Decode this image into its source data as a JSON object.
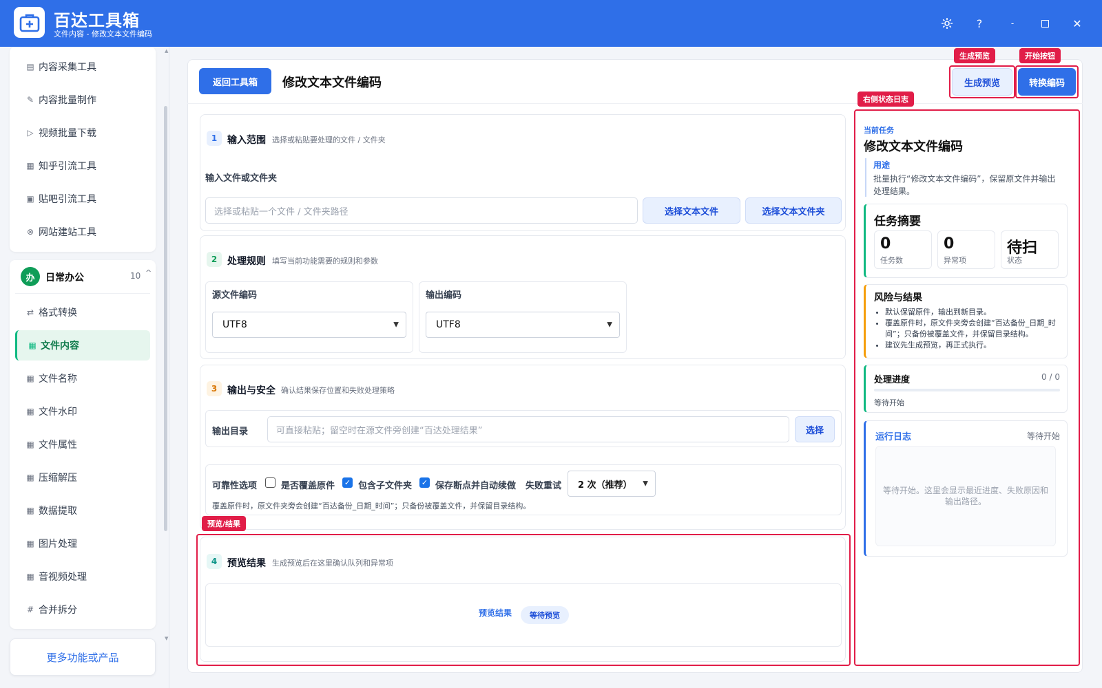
{
  "app": {
    "title": "百达工具箱",
    "subtitle": "文件内容 - 修改文本文件编码"
  },
  "window_controls": {
    "help": "?",
    "minimize": "-",
    "close": "✕"
  },
  "sidebar": {
    "group1_items": [
      {
        "label": "内容采集工具",
        "icon": "document-icon"
      },
      {
        "label": "内容批量制作",
        "icon": "pencil-icon"
      },
      {
        "label": "视频批量下载",
        "icon": "video-icon"
      },
      {
        "label": "知乎引流工具",
        "icon": "zhihu-icon"
      },
      {
        "label": "贴吧引流工具",
        "icon": "tieba-icon"
      },
      {
        "label": "网站建站工具",
        "icon": "web-icon"
      }
    ],
    "group2": {
      "badge": "办",
      "label": "日常办公",
      "count": "10"
    },
    "group2_items": [
      {
        "label": "格式转换",
        "icon": "swap-icon"
      },
      {
        "label": "文件内容",
        "icon": "grid-icon"
      },
      {
        "label": "文件名称",
        "icon": "grid-icon"
      },
      {
        "label": "文件水印",
        "icon": "grid-icon"
      },
      {
        "label": "文件属性",
        "icon": "grid-icon"
      },
      {
        "label": "压缩解压",
        "icon": "grid-icon"
      },
      {
        "label": "数据提取",
        "icon": "grid-icon"
      },
      {
        "label": "图片处理",
        "icon": "grid-icon"
      },
      {
        "label": "音视频处理",
        "icon": "grid-icon"
      },
      {
        "label": "合并拆分",
        "icon": "hash-icon"
      }
    ],
    "more": "更多功能或产品"
  },
  "header": {
    "back": "返回工具箱",
    "title": "修改文本文件编码",
    "preview_btn": "生成预览",
    "start_btn": "转换编码"
  },
  "sections": {
    "s1": {
      "num": "1",
      "title": "输入范围",
      "desc": "选择或粘贴要处理的文件 / 文件夹",
      "field_label": "输入文件或文件夹",
      "placeholder": "选择或粘贴一个文件 / 文件夹路径",
      "btn_file": "选择文本文件",
      "btn_folder": "选择文本文件夹"
    },
    "s2": {
      "num": "2",
      "title": "处理规则",
      "desc": "填写当前功能需要的规则和参数",
      "src_label": "源文件编码",
      "src_value": "UTF8",
      "out_label": "输出编码",
      "out_value": "UTF8"
    },
    "s3": {
      "num": "3",
      "title": "输出与安全",
      "desc": "确认结果保存位置和失败处理策略",
      "dir_label": "输出目录",
      "dir_placeholder": "可直接粘贴；留空时在源文件旁创建“百达处理结果”",
      "dir_btn": "选择",
      "rel_label": "可靠性选项",
      "opt_overwrite": "是否覆盖原件",
      "opt_subfolder": "包含子文件夹",
      "opt_resume": "保存断点并自动续做",
      "retry_label": "失败重试",
      "retry_value": "2 次（推荐）",
      "note": "覆盖原件时，原文件夹旁会创建“百达备份_日期_时间”；只备份被覆盖文件，并保留目录结构。"
    },
    "s4": {
      "num": "4",
      "title": "预览结果",
      "desc": "生成预览后在这里确认队列和异常项",
      "result_label": "预览结果",
      "result_status": "等待预览"
    }
  },
  "annotations": {
    "preview_tag": "生成预览",
    "start_tag": "开始按钮",
    "log_tag": "右侧状态日志",
    "result_tag": "预览/结果"
  },
  "right": {
    "current_label": "当前任务",
    "task_title": "修改文本文件编码",
    "purpose_label": "用途",
    "purpose_text": "批量执行“修改文本文件编码”，保留原文件并输出处理结果。",
    "summary_title": "任务摘要",
    "stats": [
      {
        "value": "0",
        "label": "任务数"
      },
      {
        "value": "0",
        "label": "异常项"
      },
      {
        "value": "待扫",
        "label": "状态"
      }
    ],
    "risk_title": "风险与结果",
    "risks": [
      "默认保留原件，输出到新目录。",
      "覆盖原件时，原文件夹旁会创建“百达备份_日期_时间”；只备份被覆盖文件，并保留目录结构。",
      "建议先生成预览，再正式执行。"
    ],
    "progress_title": "处理进度",
    "progress_count": "0 / 0",
    "progress_status": "等待开始",
    "progress_fraction": 0,
    "log_title": "运行日志",
    "log_status": "等待开始",
    "log_placeholder": "等待开始。这里会显示最近进度、失败原因和输出路径。"
  },
  "colors": {
    "primary": "#2f6fe8",
    "accent_green": "#10b981",
    "annotation_red": "#e11d48"
  }
}
